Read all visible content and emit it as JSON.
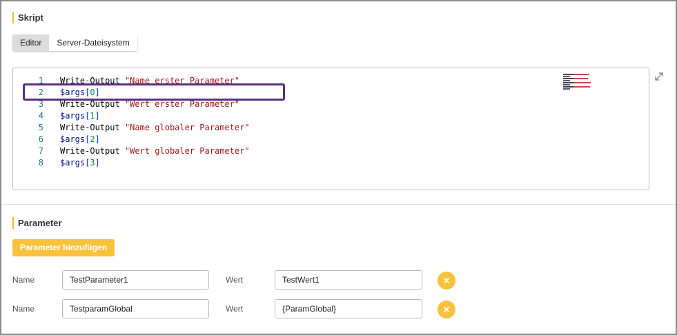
{
  "skript": {
    "title": "Skript",
    "tabs": [
      {
        "label": "Editor",
        "active": true
      },
      {
        "label": "Server-Dateisystem",
        "active": false
      }
    ],
    "code_lines": [
      {
        "number": "1",
        "parts": [
          {
            "text": "Write-Output ",
            "cls": "cmd"
          },
          {
            "text": "\"Name erster Parameter\"",
            "cls": "str"
          }
        ]
      },
      {
        "number": "2",
        "parts": [
          {
            "text": "$args",
            "cls": "var"
          },
          {
            "text": "[",
            "cls": "brk"
          },
          {
            "text": "0",
            "cls": "num"
          },
          {
            "text": "]",
            "cls": "brk"
          }
        ]
      },
      {
        "number": "3",
        "parts": [
          {
            "text": "Write-Output ",
            "cls": "cmd"
          },
          {
            "text": "\"Wert erster Parameter\"",
            "cls": "str"
          }
        ]
      },
      {
        "number": "4",
        "parts": [
          {
            "text": "$args",
            "cls": "var"
          },
          {
            "text": "[",
            "cls": "brk"
          },
          {
            "text": "1",
            "cls": "num"
          },
          {
            "text": "]",
            "cls": "brk"
          }
        ]
      },
      {
        "number": "5",
        "parts": [
          {
            "text": "Write-Output ",
            "cls": "cmd"
          },
          {
            "text": "\"Name globaler Parameter\"",
            "cls": "str"
          }
        ]
      },
      {
        "number": "6",
        "parts": [
          {
            "text": "$args",
            "cls": "var"
          },
          {
            "text": "[",
            "cls": "brk"
          },
          {
            "text": "2",
            "cls": "num"
          },
          {
            "text": "]",
            "cls": "brk"
          }
        ]
      },
      {
        "number": "7",
        "parts": [
          {
            "text": "Write-Output ",
            "cls": "cmd"
          },
          {
            "text": "\"Wert globaler Parameter\"",
            "cls": "str"
          }
        ]
      },
      {
        "number": "8",
        "parts": [
          {
            "text": "$args",
            "cls": "var"
          },
          {
            "text": "[",
            "cls": "brk"
          },
          {
            "text": "3",
            "cls": "num"
          },
          {
            "text": "]",
            "cls": "brk"
          }
        ]
      }
    ],
    "highlighted_line": "2",
    "expand_icon": "expand-icon"
  },
  "parameter": {
    "title": "Parameter",
    "add_button_label": "Parameter hinzufügen",
    "rows": [
      {
        "name_label": "Name",
        "name_value": "TestParameter1",
        "value_label": "Wert",
        "value_value": "TestWert1",
        "remove_icon": "close-icon"
      },
      {
        "name_label": "Name",
        "name_value": "TestparamGlobal",
        "value_label": "Wert",
        "value_value": "{ParamGlobal}",
        "remove_icon": "close-icon"
      }
    ]
  },
  "colors": {
    "accent": "#f9c23c",
    "highlight_border": "#5a2d82",
    "section_bar": "#f5b82e"
  }
}
